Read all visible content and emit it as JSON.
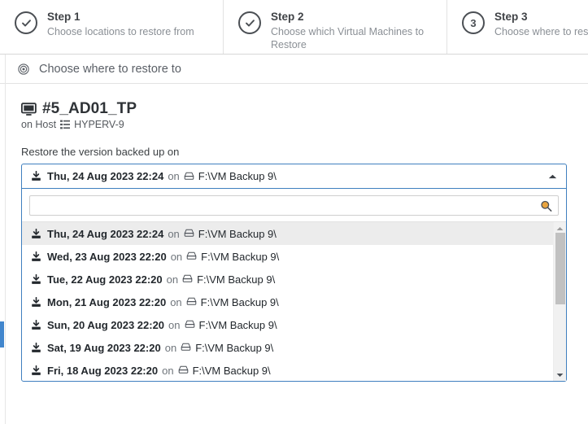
{
  "wizard": {
    "steps": [
      {
        "title": "Step 1",
        "description": "Choose locations to restore from",
        "state": "complete",
        "icon": "check-icon",
        "number": "1"
      },
      {
        "title": "Step 2",
        "description": "Choose which Virtual Machines to Restore",
        "state": "complete",
        "icon": "check-icon",
        "number": "2"
      },
      {
        "title": "Step 3",
        "description": "Choose where to restore to",
        "state": "active",
        "icon": "number",
        "number": "3"
      }
    ]
  },
  "section": {
    "icon": "target-icon",
    "title": "Choose where to restore to"
  },
  "vm": {
    "icon": "monitor-icon",
    "name": "#5_AD01_TP",
    "host_prefix": "on Host",
    "host_icon": "server-list-icon",
    "host_name": "HYPERV-9"
  },
  "restore": {
    "field_label": "Restore the version backed up on",
    "selected": {
      "icon": "save-icon",
      "date": "Thu, 24 Aug 2023 22:24",
      "separator": "on",
      "drive_icon": "drive-icon",
      "path": "F:\\VM Backup 9\\"
    },
    "caret_icon": "chevron-up-icon",
    "search": {
      "value": "",
      "placeholder": "",
      "icon": "search-icon"
    },
    "options": [
      {
        "icon": "save-icon",
        "date": "Thu, 24 Aug 2023 22:24",
        "separator": "on",
        "drive_icon": "drive-icon",
        "path": "F:\\VM Backup 9\\",
        "selected": true
      },
      {
        "icon": "save-icon",
        "date": "Wed, 23 Aug 2023 22:20",
        "separator": "on",
        "drive_icon": "drive-icon",
        "path": "F:\\VM Backup 9\\",
        "selected": false
      },
      {
        "icon": "save-icon",
        "date": "Tue, 22 Aug 2023 22:20",
        "separator": "on",
        "drive_icon": "drive-icon",
        "path": "F:\\VM Backup 9\\",
        "selected": false
      },
      {
        "icon": "save-icon",
        "date": "Mon, 21 Aug 2023 22:20",
        "separator": "on",
        "drive_icon": "drive-icon",
        "path": "F:\\VM Backup 9\\",
        "selected": false
      },
      {
        "icon": "save-icon",
        "date": "Sun, 20 Aug 2023 22:20",
        "separator": "on",
        "drive_icon": "drive-icon",
        "path": "F:\\VM Backup 9\\",
        "selected": false
      },
      {
        "icon": "save-icon",
        "date": "Sat, 19 Aug 2023 22:20",
        "separator": "on",
        "drive_icon": "drive-icon",
        "path": "F:\\VM Backup 9\\",
        "selected": false
      },
      {
        "icon": "save-icon",
        "date": "Fri, 18 Aug 2023 22:20",
        "separator": "on",
        "drive_icon": "drive-icon",
        "path": "F:\\VM Backup 9\\",
        "selected": false
      }
    ],
    "scrollbar": {
      "up_icon": "scroll-up-arrow-icon",
      "down_icon": "scroll-down-arrow-icon"
    }
  },
  "colors": {
    "accent": "#3f7fbf",
    "strip": "#4186cd",
    "selected_row": "#ececec",
    "text": "#23282d",
    "muted": "#6f757b"
  }
}
